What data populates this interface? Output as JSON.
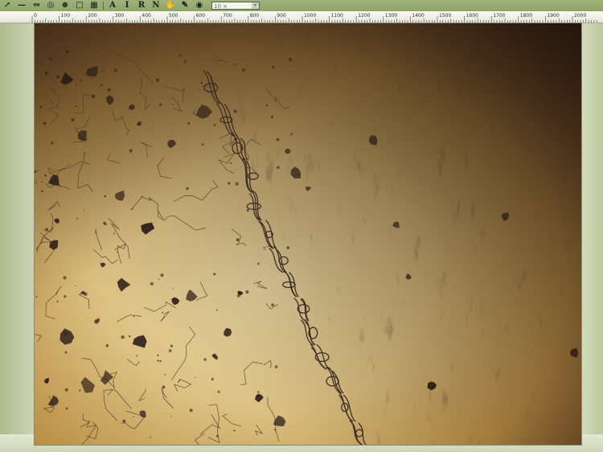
{
  "toolbar": {
    "tools": [
      {
        "name": "lasso-icon",
        "glyph": "↗"
      },
      {
        "name": "line-tool-icon",
        "glyph": "—"
      },
      {
        "name": "measure-icon",
        "glyph": "⤆"
      },
      {
        "name": "target-icon",
        "glyph": "◎"
      },
      {
        "name": "crosshair-icon",
        "glyph": "⊕"
      },
      {
        "name": "copy-icon",
        "glyph": "□"
      },
      {
        "name": "grid-icon",
        "glyph": "▦"
      },
      {
        "name": "text-a-icon",
        "glyph": "A"
      },
      {
        "name": "text-i-icon",
        "glyph": "I"
      },
      {
        "name": "text-r-icon",
        "glyph": "R"
      },
      {
        "name": "text-n-icon",
        "glyph": "N"
      },
      {
        "name": "hand-icon",
        "glyph": "✋"
      },
      {
        "name": "pen-icon",
        "glyph": "✎"
      },
      {
        "name": "camera-icon",
        "glyph": "◉"
      }
    ],
    "zoom_value": "10 ×"
  },
  "ruler": {
    "labels": [
      "0",
      "100",
      "200",
      "300",
      "400",
      "500",
      "600",
      "700",
      "800",
      "900",
      "1000",
      "1100",
      "1200",
      "1300",
      "1400",
      "1500",
      "1600",
      "1700",
      "1800",
      "1900",
      "2000"
    ],
    "unit": "px"
  },
  "colors": {
    "image_base": "#d6b768",
    "image_dark": "#3b2516",
    "boundary": "#4a3a2e"
  }
}
